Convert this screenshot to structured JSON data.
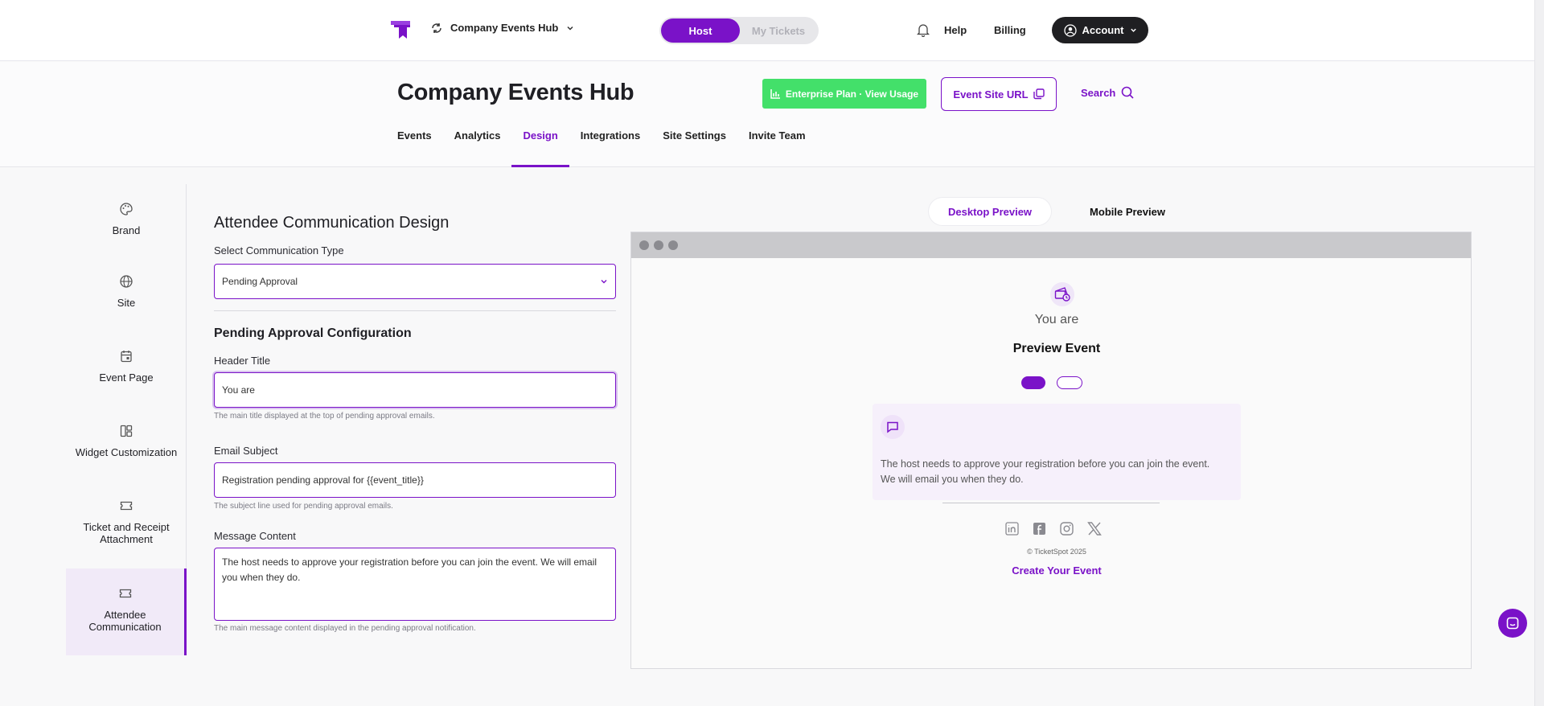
{
  "topbar": {
    "hub_name": "Company Events Hub",
    "toggle": {
      "active": "Host",
      "inactive": "My Tickets"
    },
    "help": "Help",
    "billing": "Billing",
    "account": "Account"
  },
  "header": {
    "title": "Company Events Hub",
    "plan_button": "Enterprise Plan · View Usage",
    "site_url_button": "Event Site URL",
    "search": "Search",
    "tabs": [
      "Events",
      "Analytics",
      "Design",
      "Integrations",
      "Site Settings",
      "Invite Team"
    ],
    "active_tab": "Design"
  },
  "sidebar": {
    "items": [
      {
        "label": "Brand",
        "icon": "palette-icon"
      },
      {
        "label": "Site",
        "icon": "globe-icon"
      },
      {
        "label": "Event Page",
        "icon": "calendar-icon"
      },
      {
        "label": "Widget Customization",
        "icon": "layout-icon"
      },
      {
        "label": "Ticket and Receipt Attachment",
        "icon": "ticket-icon"
      },
      {
        "label": "Attendee Communication",
        "icon": "ticket-icon"
      }
    ],
    "active_index": 5
  },
  "form": {
    "title": "Attendee Communication Design",
    "type_label": "Select Communication Type",
    "type_value": "Pending Approval",
    "section_title": "Pending Approval Configuration",
    "header_title_label": "Header Title",
    "header_title_value": "You are",
    "header_title_help": "The main title displayed at the top of pending approval emails.",
    "subject_label": "Email Subject",
    "subject_value": "Registration pending approval for {{event_title}}",
    "subject_help": "The subject line used for pending approval emails.",
    "message_label": "Message Content",
    "message_value": "The host needs to approve your registration before you can join the event. We will email you when they do.",
    "message_help": "The main message content displayed in the pending approval notification."
  },
  "preview": {
    "tabs": [
      "Desktop Preview",
      "Mobile Preview"
    ],
    "active_tab": "Desktop Preview",
    "email": {
      "header": "You are",
      "event_name": "Preview Event",
      "message": "The host needs to approve your registration before you can join the event. We will email you when they do.",
      "social_icons": [
        "linkedin-icon",
        "facebook-icon",
        "instagram-icon",
        "x-icon"
      ],
      "copyright": "© TicketSpot 2025",
      "cta": "Create Your Event"
    }
  },
  "colors": {
    "accent": "#7a12c8",
    "success": "#43e06a",
    "dark": "#1f1f22"
  }
}
